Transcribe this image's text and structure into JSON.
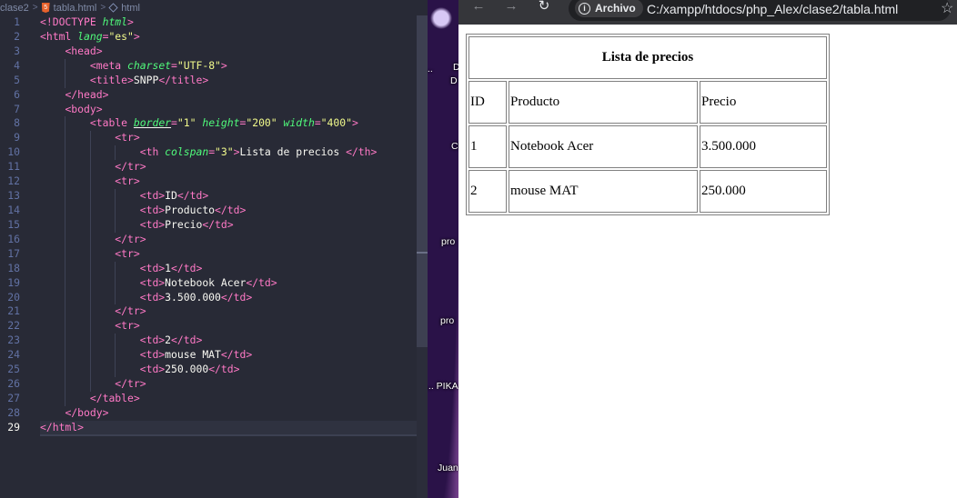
{
  "editor": {
    "breadcrumb": {
      "folder": "clase2",
      "file": "tabla.html",
      "symbol": "html"
    },
    "active_line": 29
  },
  "desktop": {
    "labels": [
      "D",
      "D",
      "...",
      "Ci",
      "pro",
      "pro",
      "... PIKA",
      "Juan"
    ]
  },
  "browser": {
    "security_chip": "Archivo",
    "url": "C:/xampp/htdocs/php_Alex/clase2/tabla.html",
    "icons": {
      "back": "back-arrow-icon",
      "forward": "forward-arrow-icon",
      "reload": "reload-icon",
      "info": "info-icon",
      "bookmark": "star-icon"
    },
    "page": {
      "title_cell": "Lista de precios",
      "headers": [
        "ID",
        "Producto",
        "Precio"
      ],
      "rows": [
        [
          "1",
          "Notebook Acer",
          "3.500.000"
        ],
        [
          "2",
          "mouse MAT",
          "250.000"
        ]
      ]
    }
  },
  "colors": {
    "editor_bg": "#282a36",
    "tag": "#ff79c6",
    "attribute": "#50fa7b",
    "string": "#f1fa8c",
    "line_number": "#6272a4",
    "browser_toolbar": "#35363a"
  }
}
